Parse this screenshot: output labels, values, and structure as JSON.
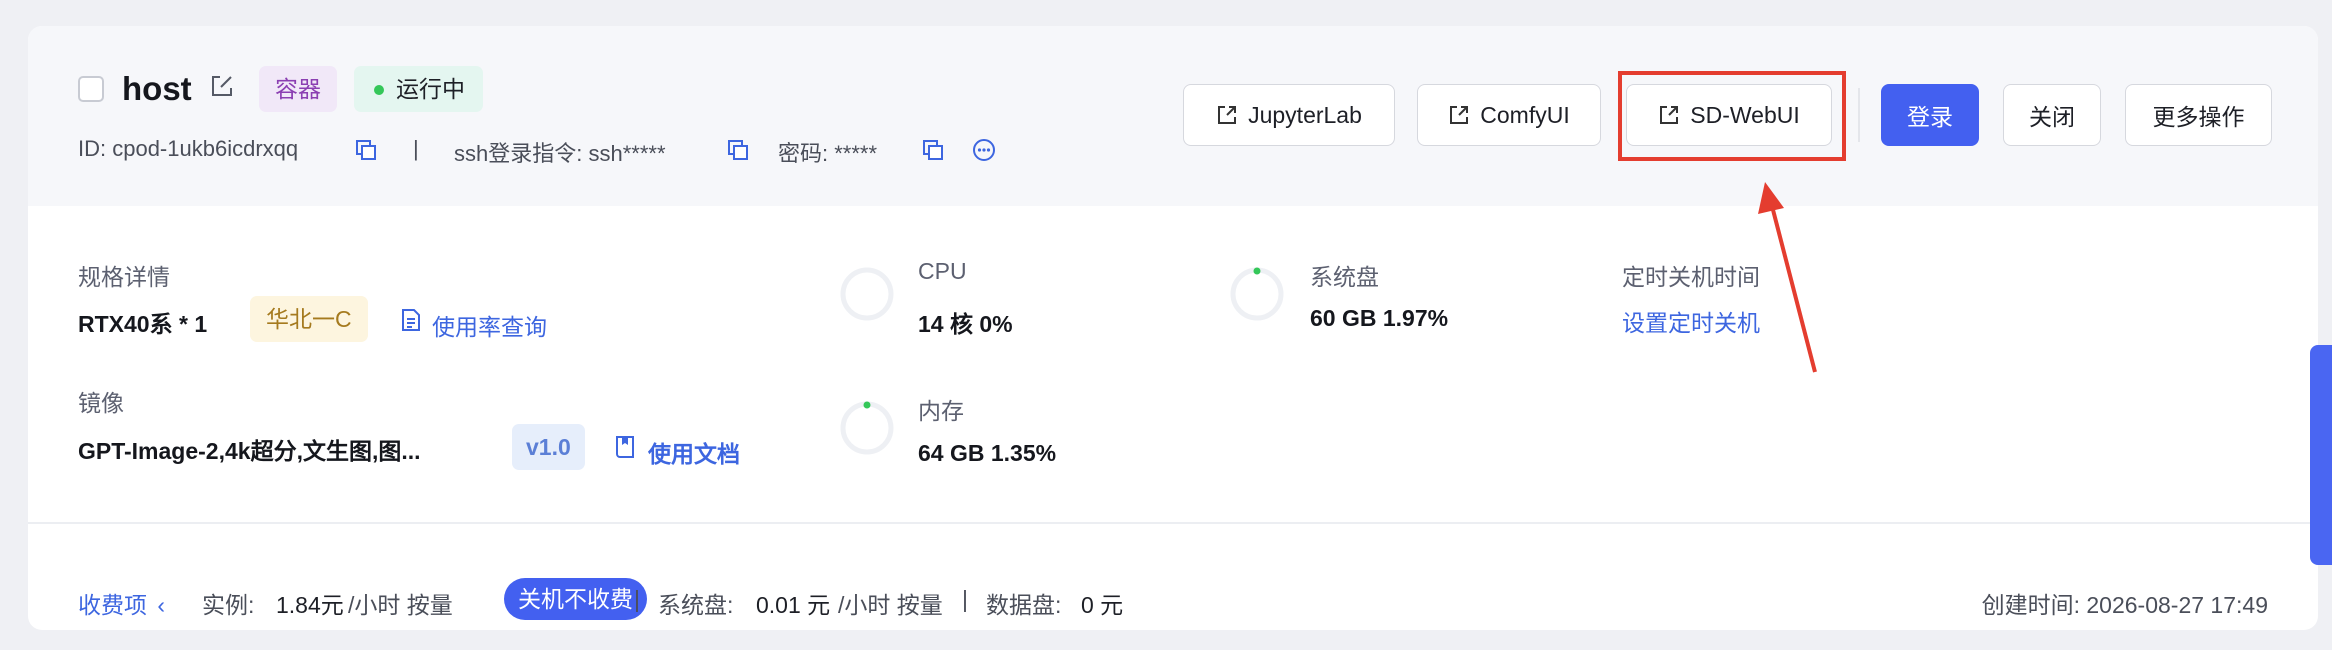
{
  "instance": {
    "name": "host",
    "type_tag": "容器",
    "status": "运行中",
    "id_label": "ID: cpod-1ukb6icdrxqq",
    "meta_separator": "|",
    "ssh_label": "ssh登录指令: ssh*****",
    "password_label": "密码: *****"
  },
  "actions": {
    "jupyterlab": "JupyterLab",
    "comfyui": "ComfyUI",
    "sdwebui": "SD-WebUI",
    "login": "登录",
    "close": "关闭",
    "more": "更多操作"
  },
  "spec": {
    "label": "规格详情",
    "value": "RTX40系 * 1",
    "region": "华北一C",
    "usage_link": "使用率查询"
  },
  "image": {
    "label": "镜像",
    "value": "GPT-Image-2,4k超分,文生图,图...",
    "version": "v1.0",
    "docs_link": "使用文档"
  },
  "cpu": {
    "label": "CPU",
    "value": "14 核 0%",
    "percent": 0
  },
  "memory": {
    "label": "内存",
    "value": "64 GB 1.35%",
    "percent": 1.35
  },
  "disk": {
    "label": "系统盘",
    "value": "60 GB 1.97%",
    "percent": 1.97
  },
  "shutdown": {
    "label": "定时关机时间",
    "link": "设置定时关机"
  },
  "billing": {
    "toggle": "收费项",
    "instance_label": "实例:",
    "instance_price": "1.84元",
    "instance_unit": "/小时 按量",
    "no_charge_pill": "关机不收费",
    "sep1": "|",
    "disk_label": "系统盘:",
    "disk_price": "0.01 元",
    "disk_unit": "/小时 按量",
    "sep2": "|",
    "data_label": "数据盘:",
    "data_price": "0 元"
  },
  "created_at": "创建时间: 2026-08-27 17:49",
  "colors": {
    "accent": "#4360f0",
    "running_dot": "#34c759",
    "highlight": "#e43d2f"
  }
}
